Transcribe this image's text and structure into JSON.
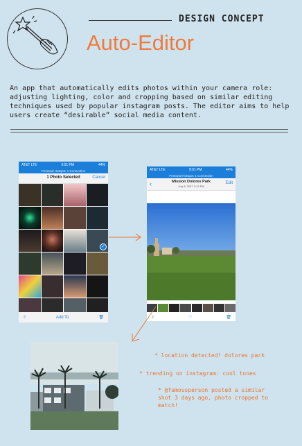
{
  "header": {
    "eyebrow": "DESIGN CONCEPT",
    "title": "Auto-Editor",
    "icon": "magic-wand-icon"
  },
  "description": "An app that automatically edits photos within your camera role: adjusting lighting, color and cropping based on similar editing techniques used by popular instagram posts. The editor aims to help users create “desirable” social media content.",
  "phone_left": {
    "status_carrier": "AT&T LTE",
    "status_time": "9:01 PM",
    "status_battery": "44%",
    "hotspot": "Personal Hotspot: 1 Connection",
    "nav_title": "1 Photo Selected",
    "nav_cancel": "Cancel",
    "toolbar_add": "Add To",
    "icons": [
      "share-icon",
      "trash-icon",
      "checkmark-icon"
    ]
  },
  "phone_right": {
    "status_carrier": "AT&T LTE",
    "status_time": "9:01 PM",
    "status_battery": "44%",
    "hotspot": "Personal Hotspot: 1 Connection",
    "nav_title": "Mission Dolores Park",
    "nav_subtitle": "July 8, 2017  3:12 PM",
    "nav_edit": "Edit",
    "icons": [
      "back-chevron-icon",
      "share-icon",
      "heart-icon",
      "trash-icon"
    ]
  },
  "notes": {
    "location": "* location detected! dolores park",
    "trending": "* trending on instagram: cool tones",
    "famous": "* @famousperson posted a similar shot 3 days ago, photo cropped to match!"
  },
  "colors": {
    "background": "#cfe3ee",
    "accent": "#f07a3c",
    "ios_blue": "#1b7fd9"
  }
}
